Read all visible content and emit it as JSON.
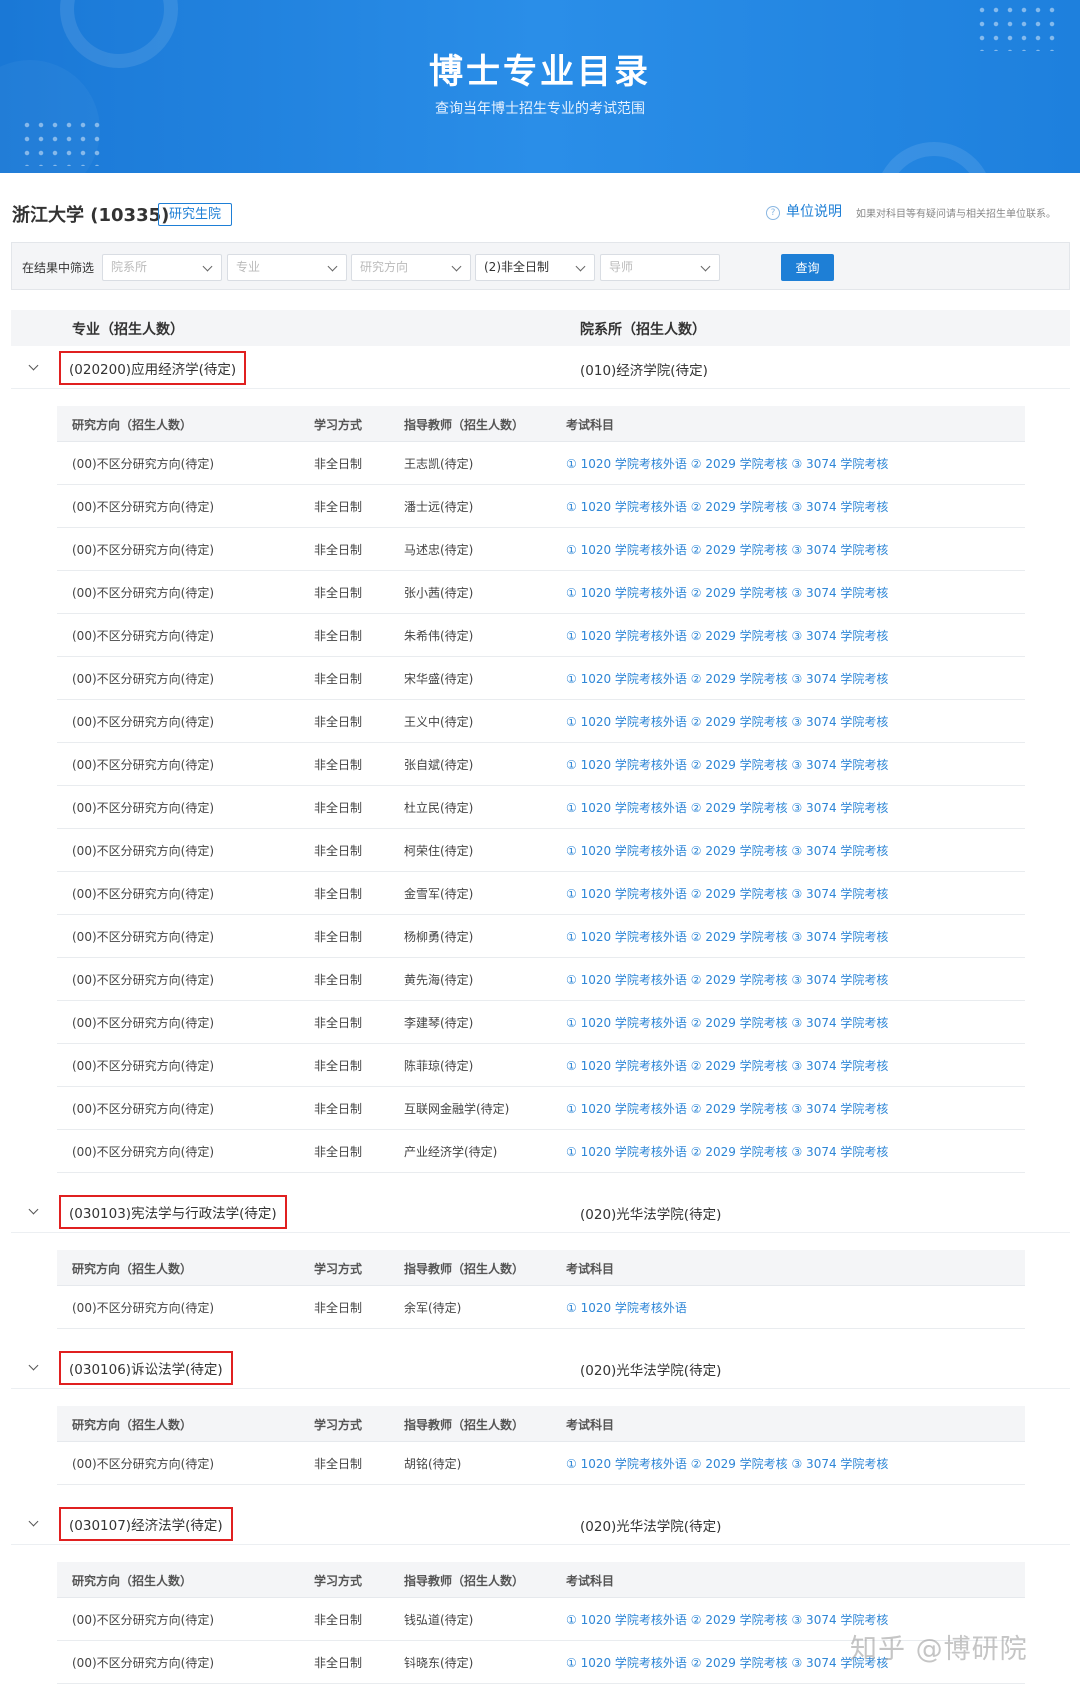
{
  "banner": {
    "title": "博士专业目录",
    "subtitle": "查询当年博士招生专业的考试范围"
  },
  "header": {
    "university": "浙江大学 (10335)",
    "badge": "研究生院",
    "unit_note_icon": "help-circle-icon",
    "unit_note": "单位说明",
    "unit_hint": "如果对科目等有疑问请与相关招生单位联系。"
  },
  "filter": {
    "label": "在结果中筛选",
    "selects": [
      {
        "placeholder": "院系所"
      },
      {
        "placeholder": "专业"
      },
      {
        "placeholder": "研究方向"
      },
      {
        "value": "(2)非全日制"
      },
      {
        "placeholder": "导师"
      }
    ],
    "query_label": "查询"
  },
  "main_table": {
    "col_major": "专业（招生人数）",
    "col_dept": "院系所（招生人数）"
  },
  "sub_headers": {
    "direction": "研究方向（招生人数）",
    "mode": "学习方式",
    "advisor": "指导教师（招生人数）",
    "exam": "考试科目"
  },
  "majors": [
    {
      "name": "(020200)应用经济学(待定)",
      "dept": "(010)经济学院(待定)",
      "rows": [
        {
          "direction": "(00)不区分研究方向(待定)",
          "mode": "非全日制",
          "advisor": "王志凯(待定)",
          "exam": "① 1020 学院考核外语 ② 2029 学院考核 ③ 3074 学院考核"
        },
        {
          "direction": "(00)不区分研究方向(待定)",
          "mode": "非全日制",
          "advisor": "潘士远(待定)",
          "exam": "① 1020 学院考核外语 ② 2029 学院考核 ③ 3074 学院考核"
        },
        {
          "direction": "(00)不区分研究方向(待定)",
          "mode": "非全日制",
          "advisor": "马述忠(待定)",
          "exam": "① 1020 学院考核外语 ② 2029 学院考核 ③ 3074 学院考核"
        },
        {
          "direction": "(00)不区分研究方向(待定)",
          "mode": "非全日制",
          "advisor": "张小茜(待定)",
          "exam": "① 1020 学院考核外语 ② 2029 学院考核 ③ 3074 学院考核"
        },
        {
          "direction": "(00)不区分研究方向(待定)",
          "mode": "非全日制",
          "advisor": "朱希伟(待定)",
          "exam": "① 1020 学院考核外语 ② 2029 学院考核 ③ 3074 学院考核"
        },
        {
          "direction": "(00)不区分研究方向(待定)",
          "mode": "非全日制",
          "advisor": "宋华盛(待定)",
          "exam": "① 1020 学院考核外语 ② 2029 学院考核 ③ 3074 学院考核"
        },
        {
          "direction": "(00)不区分研究方向(待定)",
          "mode": "非全日制",
          "advisor": "王义中(待定)",
          "exam": "① 1020 学院考核外语 ② 2029 学院考核 ③ 3074 学院考核"
        },
        {
          "direction": "(00)不区分研究方向(待定)",
          "mode": "非全日制",
          "advisor": "张自斌(待定)",
          "exam": "① 1020 学院考核外语 ② 2029 学院考核 ③ 3074 学院考核"
        },
        {
          "direction": "(00)不区分研究方向(待定)",
          "mode": "非全日制",
          "advisor": "杜立民(待定)",
          "exam": "① 1020 学院考核外语 ② 2029 学院考核 ③ 3074 学院考核"
        },
        {
          "direction": "(00)不区分研究方向(待定)",
          "mode": "非全日制",
          "advisor": "柯荣住(待定)",
          "exam": "① 1020 学院考核外语 ② 2029 学院考核 ③ 3074 学院考核"
        },
        {
          "direction": "(00)不区分研究方向(待定)",
          "mode": "非全日制",
          "advisor": "金雪军(待定)",
          "exam": "① 1020 学院考核外语 ② 2029 学院考核 ③ 3074 学院考核"
        },
        {
          "direction": "(00)不区分研究方向(待定)",
          "mode": "非全日制",
          "advisor": "杨柳勇(待定)",
          "exam": "① 1020 学院考核外语 ② 2029 学院考核 ③ 3074 学院考核"
        },
        {
          "direction": "(00)不区分研究方向(待定)",
          "mode": "非全日制",
          "advisor": "黄先海(待定)",
          "exam": "① 1020 学院考核外语 ② 2029 学院考核 ③ 3074 学院考核"
        },
        {
          "direction": "(00)不区分研究方向(待定)",
          "mode": "非全日制",
          "advisor": "李建琴(待定)",
          "exam": "① 1020 学院考核外语 ② 2029 学院考核 ③ 3074 学院考核"
        },
        {
          "direction": "(00)不区分研究方向(待定)",
          "mode": "非全日制",
          "advisor": "陈菲琼(待定)",
          "exam": "① 1020 学院考核外语 ② 2029 学院考核 ③ 3074 学院考核"
        },
        {
          "direction": "(00)不区分研究方向(待定)",
          "mode": "非全日制",
          "advisor": "互联网金融学(待定)",
          "exam": "① 1020 学院考核外语 ② 2029 学院考核 ③ 3074 学院考核"
        },
        {
          "direction": "(00)不区分研究方向(待定)",
          "mode": "非全日制",
          "advisor": "产业经济学(待定)",
          "exam": "① 1020 学院考核外语 ② 2029 学院考核 ③ 3074 学院考核"
        }
      ]
    },
    {
      "name": "(030103)宪法学与行政法学(待定)",
      "dept": "(020)光华法学院(待定)",
      "rows": [
        {
          "direction": "(00)不区分研究方向(待定)",
          "mode": "非全日制",
          "advisor": "余军(待定)",
          "exam": "① 1020 学院考核外语"
        }
      ]
    },
    {
      "name": "(030106)诉讼法学(待定)",
      "dept": "(020)光华法学院(待定)",
      "rows": [
        {
          "direction": "(00)不区分研究方向(待定)",
          "mode": "非全日制",
          "advisor": "胡铭(待定)",
          "exam": "① 1020 学院考核外语 ② 2029 学院考核 ③ 3074 学院考核"
        }
      ]
    },
    {
      "name": "(030107)经济法学(待定)",
      "dept": "(020)光华法学院(待定)",
      "rows": [
        {
          "direction": "(00)不区分研究方向(待定)",
          "mode": "非全日制",
          "advisor": "钱弘道(待定)",
          "exam": "① 1020 学院考核外语 ② 2029 学院考核 ③ 3074 学院考核"
        },
        {
          "direction": "(00)不区分研究方向(待定)",
          "mode": "非全日制",
          "advisor": "钭晓东(待定)",
          "exam": "① 1020 学院考核外语 ② 2029 学院考核 ③ 3074 学院考核"
        }
      ]
    }
  ],
  "watermark": "知乎 @博研院"
}
